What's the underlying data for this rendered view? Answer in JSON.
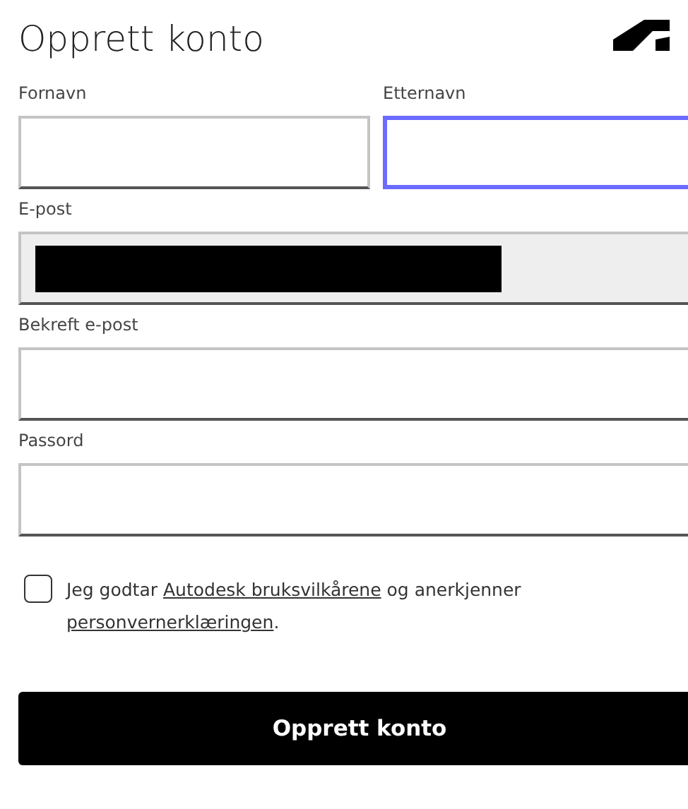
{
  "title": "Opprett konto",
  "name_fields": [
    {
      "label": "Fornavn",
      "focused": false
    },
    {
      "label": "Etternavn",
      "focused": true
    }
  ],
  "fields": [
    {
      "label": "E-post",
      "disabled": true,
      "redacted": true
    },
    {
      "label": "Bekreft e-post",
      "disabled": false,
      "redacted": false
    },
    {
      "label": "Passord",
      "disabled": false,
      "redacted": false
    }
  ],
  "consent": {
    "checked": false,
    "parts": [
      {
        "kind": "text",
        "text": "Jeg godtar "
      },
      {
        "kind": "link",
        "text": "Autodesk bruksvilkårene"
      },
      {
        "kind": "text",
        "text": " og anerkjenner "
      },
      {
        "kind": "link",
        "text": "personvernerklæringen"
      },
      {
        "kind": "text",
        "text": "."
      }
    ]
  },
  "submit": "Opprett konto"
}
